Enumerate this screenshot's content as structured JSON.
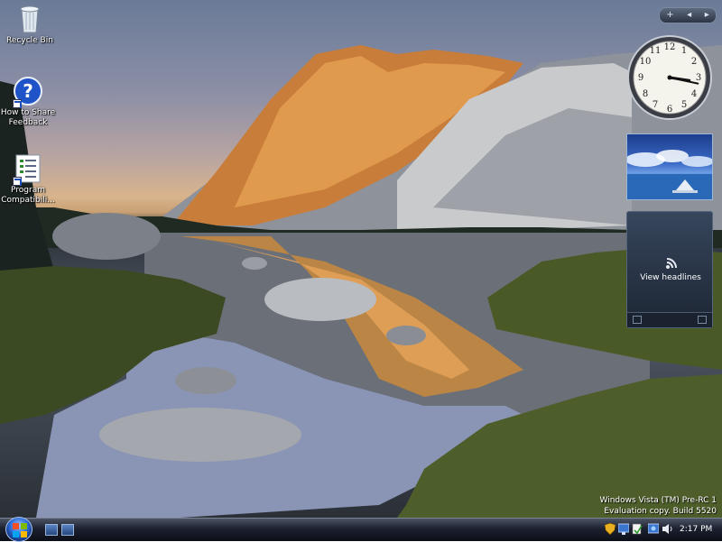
{
  "desktop": {
    "icons": [
      {
        "label": "Recycle Bin"
      },
      {
        "label": "How to Share Feedback"
      },
      {
        "label": "Program Compatibili..."
      }
    ]
  },
  "sidebar": {
    "controls": {
      "add": "+",
      "prev": "◂",
      "next": "▸"
    },
    "clock": {
      "hour": 3,
      "minute": 17
    },
    "feed": {
      "headline": "View headlines"
    }
  },
  "watermark": {
    "line1": "Windows Vista (TM) Pre-RC 1",
    "line2": "Evaluation copy. Build 5520"
  },
  "taskbar": {
    "time": "2:17 PM",
    "tray_icons": [
      "shield-icon",
      "network-icon",
      "security-icon",
      "display-icon",
      "volume-icon"
    ]
  },
  "colors": {
    "taskbar": "#1c2130",
    "accent": "#2b6ad6"
  }
}
